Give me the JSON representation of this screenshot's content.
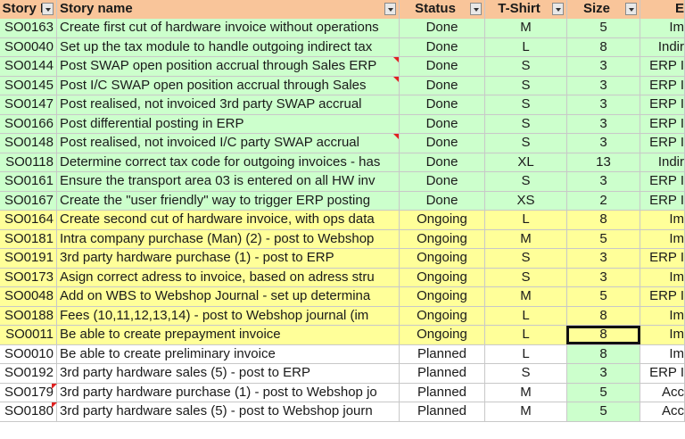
{
  "columns": {
    "id": "Story ID",
    "name": "Story name",
    "status": "Status",
    "shirt": "T-Shirt",
    "size": "Size",
    "extra": "E"
  },
  "colors": {
    "header_bg": "#f9c59a",
    "done_bg": "#ccffcc",
    "ongoing_bg": "#ffff99",
    "planned_bg": "#ffffff",
    "selection_border": "#111111",
    "comment_marker": "#e02020"
  },
  "rows": [
    {
      "id": "SO0163",
      "name": "Create first cut of hardware invoice without operations",
      "status": "Done",
      "shirt": "M",
      "size": "5",
      "extra": "Im"
    },
    {
      "id": "SO0040",
      "name": "Set up the tax module to handle outgoing indirect tax",
      "status": "Done",
      "shirt": "L",
      "size": "8",
      "extra": "Indir"
    },
    {
      "id": "SO0144",
      "name": "Post SWAP open position accrual through Sales ERP",
      "status": "Done",
      "shirt": "S",
      "size": "3",
      "extra": "ERP I",
      "comment_name": true
    },
    {
      "id": "SO0145",
      "name": "Post I/C SWAP open position accrual through Sales",
      "status": "Done",
      "shirt": "S",
      "size": "3",
      "extra": "ERP I",
      "comment_name": true
    },
    {
      "id": "SO0147",
      "name": "Post realised, not invoiced 3rd party SWAP accrual",
      "status": "Done",
      "shirt": "S",
      "size": "3",
      "extra": "ERP I"
    },
    {
      "id": "SO0166",
      "name": "Post  differential posting in ERP",
      "status": "Done",
      "shirt": "S",
      "size": "3",
      "extra": "ERP I"
    },
    {
      "id": "SO0148",
      "name": "Post realised, not invoiced I/C party SWAP accrual",
      "status": "Done",
      "shirt": "S",
      "size": "3",
      "extra": "ERP I",
      "comment_name": true
    },
    {
      "id": "SO0118",
      "name": "Determine correct tax code for outgoing invoices - has",
      "status": "Done",
      "shirt": "XL",
      "size": "13",
      "extra": "Indir"
    },
    {
      "id": "SO0161",
      "name": "Ensure the transport area 03 is entered on all HW inv",
      "status": "Done",
      "shirt": "S",
      "size": "3",
      "extra": "ERP I"
    },
    {
      "id": "SO0167",
      "name": "Create the \"user friendly\" way to trigger ERP posting",
      "status": "Done",
      "shirt": "XS",
      "size": "2",
      "extra": "ERP I"
    },
    {
      "id": "SO0164",
      "name": "Create second cut of hardware invoice, with ops data",
      "status": "Ongoing",
      "shirt": "L",
      "size": "8",
      "extra": "Im"
    },
    {
      "id": "SO0181",
      "name": "Intra company purchase (Man) (2) - post to Webshop",
      "status": "Ongoing",
      "shirt": "M",
      "size": "5",
      "extra": "Im"
    },
    {
      "id": "SO0191",
      "name": "3rd party hardware purchase (1) - post to ERP",
      "status": "Ongoing",
      "shirt": "S",
      "size": "3",
      "extra": "ERP I"
    },
    {
      "id": "SO0173",
      "name": "Asign correct adress to invoice, based on adress stru",
      "status": "Ongoing",
      "shirt": "S",
      "size": "3",
      "extra": "Im"
    },
    {
      "id": "SO0048",
      "name": "Add on WBS to Webshop Journal - set up determina",
      "status": "Ongoing",
      "shirt": "M",
      "size": "5",
      "extra": "ERP I"
    },
    {
      "id": "SO0188",
      "name": "Fees (10,11,12,13,14) - post to Webshop journal (im",
      "status": "Ongoing",
      "shirt": "L",
      "size": "8",
      "extra": "Im"
    },
    {
      "id": "SO0011",
      "name": "Be able to create prepayment invoice",
      "status": "Ongoing",
      "shirt": "L",
      "size": "8",
      "extra": "Im"
    },
    {
      "id": "SO0010",
      "name": "Be able to create preliminary invoice",
      "status": "Planned",
      "shirt": "L",
      "size": "8",
      "extra": "Im"
    },
    {
      "id": "SO0192",
      "name": "3rd party hardware sales (5) - post to ERP",
      "status": "Planned",
      "shirt": "S",
      "size": "3",
      "extra": "ERP I"
    },
    {
      "id": "SO0179",
      "name": "3rd party hardware purchase (1) - post to Webshop jo",
      "status": "Planned",
      "shirt": "M",
      "size": "5",
      "extra": "Acc",
      "comment_id": true
    },
    {
      "id": "SO0180",
      "name": "3rd party hardware sales (5) - post to Webshop journ",
      "status": "Planned",
      "shirt": "M",
      "size": "5",
      "extra": "Acc",
      "comment_id": true
    }
  ],
  "selected": {
    "row_index": 16,
    "column": "size"
  }
}
